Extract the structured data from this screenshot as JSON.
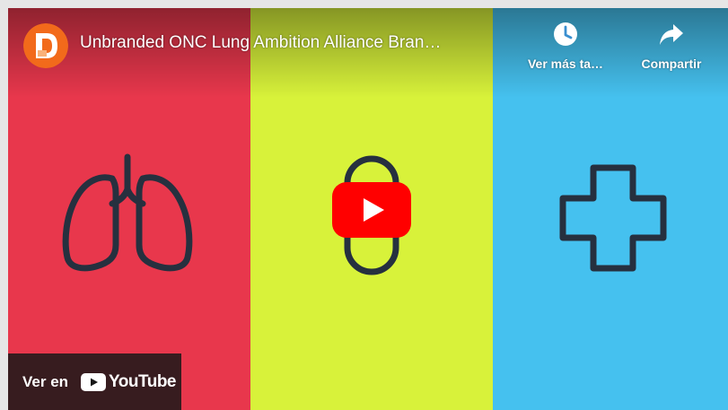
{
  "video": {
    "title": "Unbranded ONC Lung Ambition Alliance Bran…"
  },
  "channel": {
    "logo_icon": "channel-d-logo",
    "logo_color": "#f26a1b"
  },
  "actions": {
    "watch_later_label": "Ver más ta…",
    "watch_later_icon": "clock-icon",
    "share_label": "Compartir",
    "share_icon": "share-arrow-icon"
  },
  "watch_on": {
    "label": "Ver en",
    "brand": "YouTube"
  },
  "panels": [
    {
      "name": "lungs",
      "color": "#e8374c"
    },
    {
      "name": "pill",
      "color": "#d8f23a"
    },
    {
      "name": "medical-cross",
      "color": "#45c1ef"
    }
  ],
  "colors": {
    "play_red": "#ff0000",
    "icon_stroke": "#26303f"
  }
}
